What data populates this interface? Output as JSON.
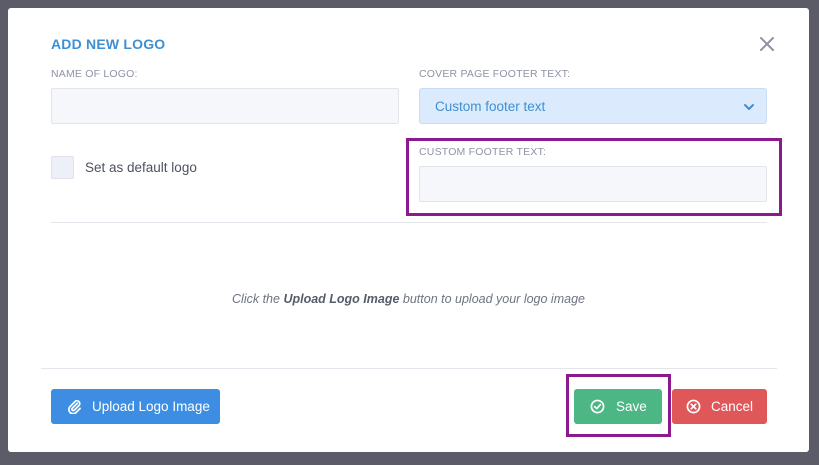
{
  "modal": {
    "title": "ADD NEW LOGO",
    "close_icon": "close-icon"
  },
  "form": {
    "name_label": "NAME OF LOGO:",
    "name_value": "",
    "footer_select_label": "COVER PAGE FOOTER TEXT:",
    "footer_select_value": "Custom footer text",
    "default_checkbox_label": "Set as default logo",
    "default_checked": false,
    "custom_footer_label": "CUSTOM FOOTER TEXT:",
    "custom_footer_value": ""
  },
  "hint": {
    "prefix": "Click the ",
    "bold": "Upload Logo Image",
    "suffix": " button to upload your logo image"
  },
  "buttons": {
    "upload": "Upload Logo Image",
    "save": "Save",
    "cancel": "Cancel"
  },
  "icons": {
    "upload": "paperclip-icon",
    "save": "check-circle-icon",
    "cancel": "x-circle-icon",
    "select": "chevron-down-icon"
  },
  "colors": {
    "title": "#3f8fd2",
    "upload_button": "#3d8ee3",
    "save_button": "#4cb784",
    "cancel_button": "#e0575a",
    "highlight": "#8b1a8e",
    "select_bg": "#dbeafc"
  }
}
